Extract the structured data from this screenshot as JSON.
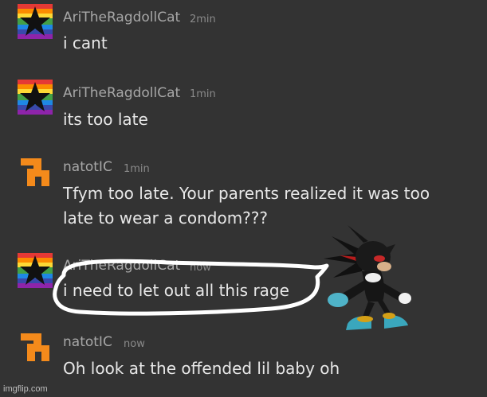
{
  "messages": [
    {
      "username": "AriTheRagdollCat",
      "time": "2min",
      "text": "i cant",
      "avatar": "rainbow-star-icon"
    },
    {
      "username": "AriTheRagdollCat",
      "time": "1min",
      "text": "its too late",
      "avatar": "rainbow-star-icon"
    },
    {
      "username": "natotIC",
      "time": "1min",
      "text_line1": "Tfym too late. Your parents realized it was too",
      "text_line2": "late to wear a condom???",
      "avatar": "orange-glyph-icon"
    },
    {
      "username": "AriTheRagdollCat",
      "time": "now",
      "text": "i need to let out all this rage",
      "avatar": "rainbow-star-icon"
    },
    {
      "username": "natotIC",
      "time": "now",
      "text": "Oh look at the offended lil baby oh",
      "avatar": "orange-glyph-icon"
    }
  ],
  "watermark": "imgflip.com",
  "colors": {
    "background": "#333333",
    "username": "#a7a7a7",
    "timestamp": "#8a8a8a",
    "message_text": "#e8e8e8",
    "orange_avatar": "#f48a1b"
  },
  "overlays": {
    "speech_bubble": "white-outline-speech-bubble",
    "character": "black-hedgehog-sticker"
  }
}
